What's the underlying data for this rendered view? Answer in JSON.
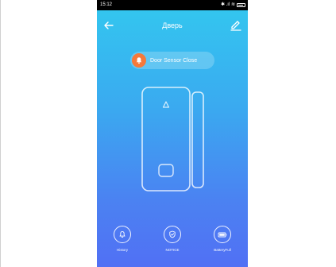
{
  "status_bar": {
    "time": "15:12",
    "signal_glyphs": "✱ .ıl ≋"
  },
  "header": {
    "title": "Дверь",
    "back_icon": "arrow-left-icon",
    "edit_icon": "pencil-icon"
  },
  "status_pill": {
    "text": "Door Sensor Close",
    "icon": "bell-icon",
    "icon_color": "#f5793a"
  },
  "device": {
    "icon": "door-sensor-illustration"
  },
  "actions": [
    {
      "label": "History",
      "icon": "bell-icon"
    },
    {
      "label": "NOTICE",
      "icon": "shield-icon"
    },
    {
      "label": "BatteryFull",
      "icon": "battery-icon"
    }
  ],
  "colors": {
    "gradient_top": "#33c8ef",
    "gradient_bottom": "#5170f4",
    "accent": "#f5793a"
  }
}
